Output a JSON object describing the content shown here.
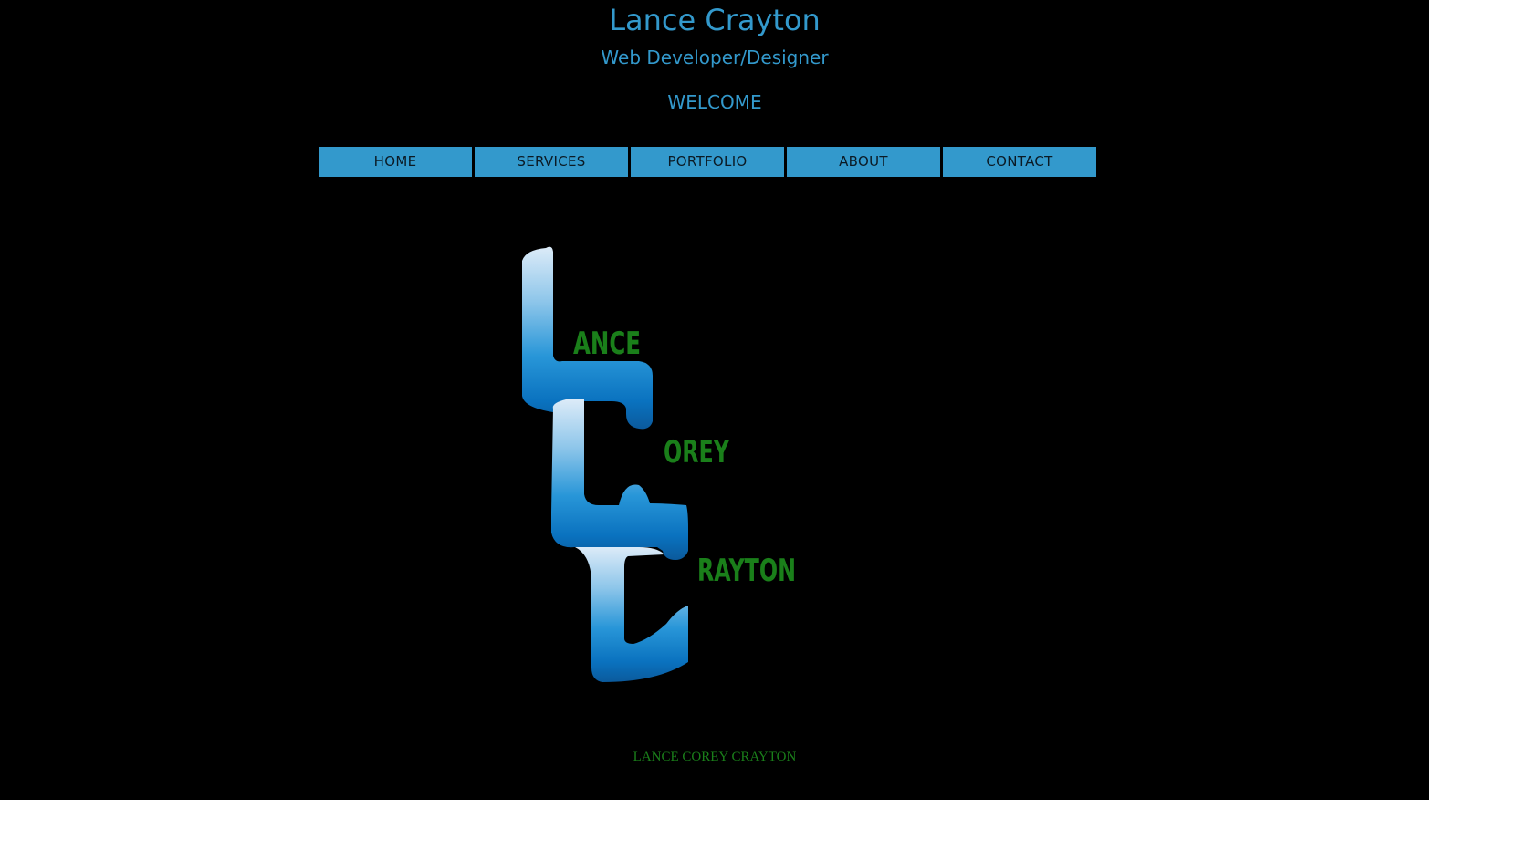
{
  "header": {
    "title": "Lance Crayton",
    "subtitle": "Web Developer/Designer",
    "welcome": "WELCOME"
  },
  "nav": {
    "items": [
      {
        "label": "HOME"
      },
      {
        "label": "SERVICES"
      },
      {
        "label": "PORTFOLIO"
      },
      {
        "label": "ABOUT"
      },
      {
        "label": "CONTACT"
      }
    ]
  },
  "logo": {
    "words": [
      "ANCE",
      "OREY",
      "RAYTON"
    ]
  },
  "footer": {
    "text": "LANCE COREY CRAYTON"
  },
  "colors": {
    "background": "#000000",
    "accent": "#3399cc",
    "logo_green": "#1a7f1a"
  }
}
